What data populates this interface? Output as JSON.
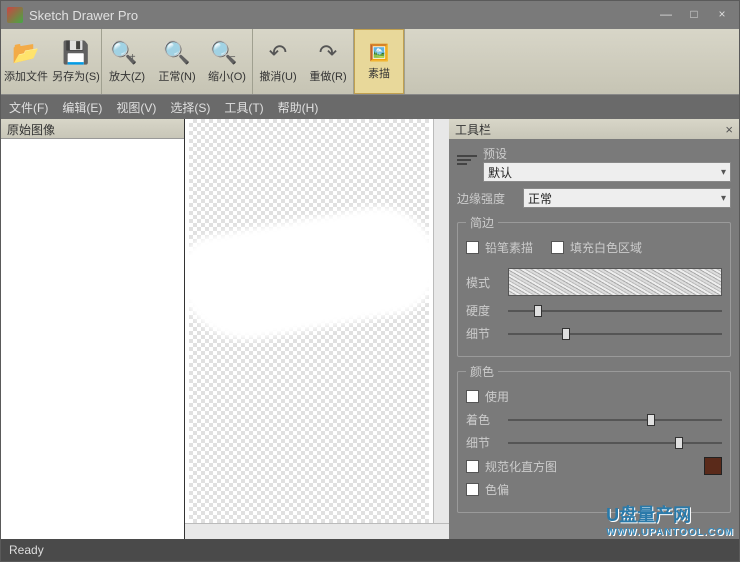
{
  "app": {
    "title": "Sketch Drawer Pro"
  },
  "winbtns": {
    "min": "—",
    "max": "□",
    "close": "×"
  },
  "toolbar": {
    "open": "添加文件",
    "save_as": "另存为(S)",
    "zoom_in": "放大(Z)",
    "zoom_normal": "正常(N)",
    "zoom_out": "缩小(O)",
    "undo": "撤消(U)",
    "redo": "重做(R)",
    "sketch": "素描"
  },
  "menu": {
    "file": "文件(F)",
    "edit": "编辑(E)",
    "view": "视图(V)",
    "select": "选择(S)",
    "tools": "工具(T)",
    "help": "帮助(H)"
  },
  "left_panel": {
    "title": "原始图像"
  },
  "right_panel": {
    "title": "工具栏",
    "preset_label": "预设",
    "preset_value": "默认",
    "edge_strength_label": "边缘强度",
    "edge_strength_value": "正常",
    "pencil_group": "简边",
    "pencil_sketch_label": "铅笔素描",
    "fill_white_label": "填充白色区域",
    "mode_label": "模式",
    "hardness_label": "硬度",
    "detail_label": "细节",
    "color_group": "颜色",
    "use_label": "使用",
    "tint_label": "着色",
    "color_detail_label": "细节",
    "normalize_hist_label": "规范化直方图",
    "color_bias_label": "色偏"
  },
  "sliders": {
    "hardness": 12,
    "detail": 25,
    "tint": 65,
    "color_detail": 78
  },
  "status": {
    "text": "Ready"
  },
  "watermark": {
    "main": "盘量产网",
    "sub": "WWW.UPANTOOL.COM"
  }
}
